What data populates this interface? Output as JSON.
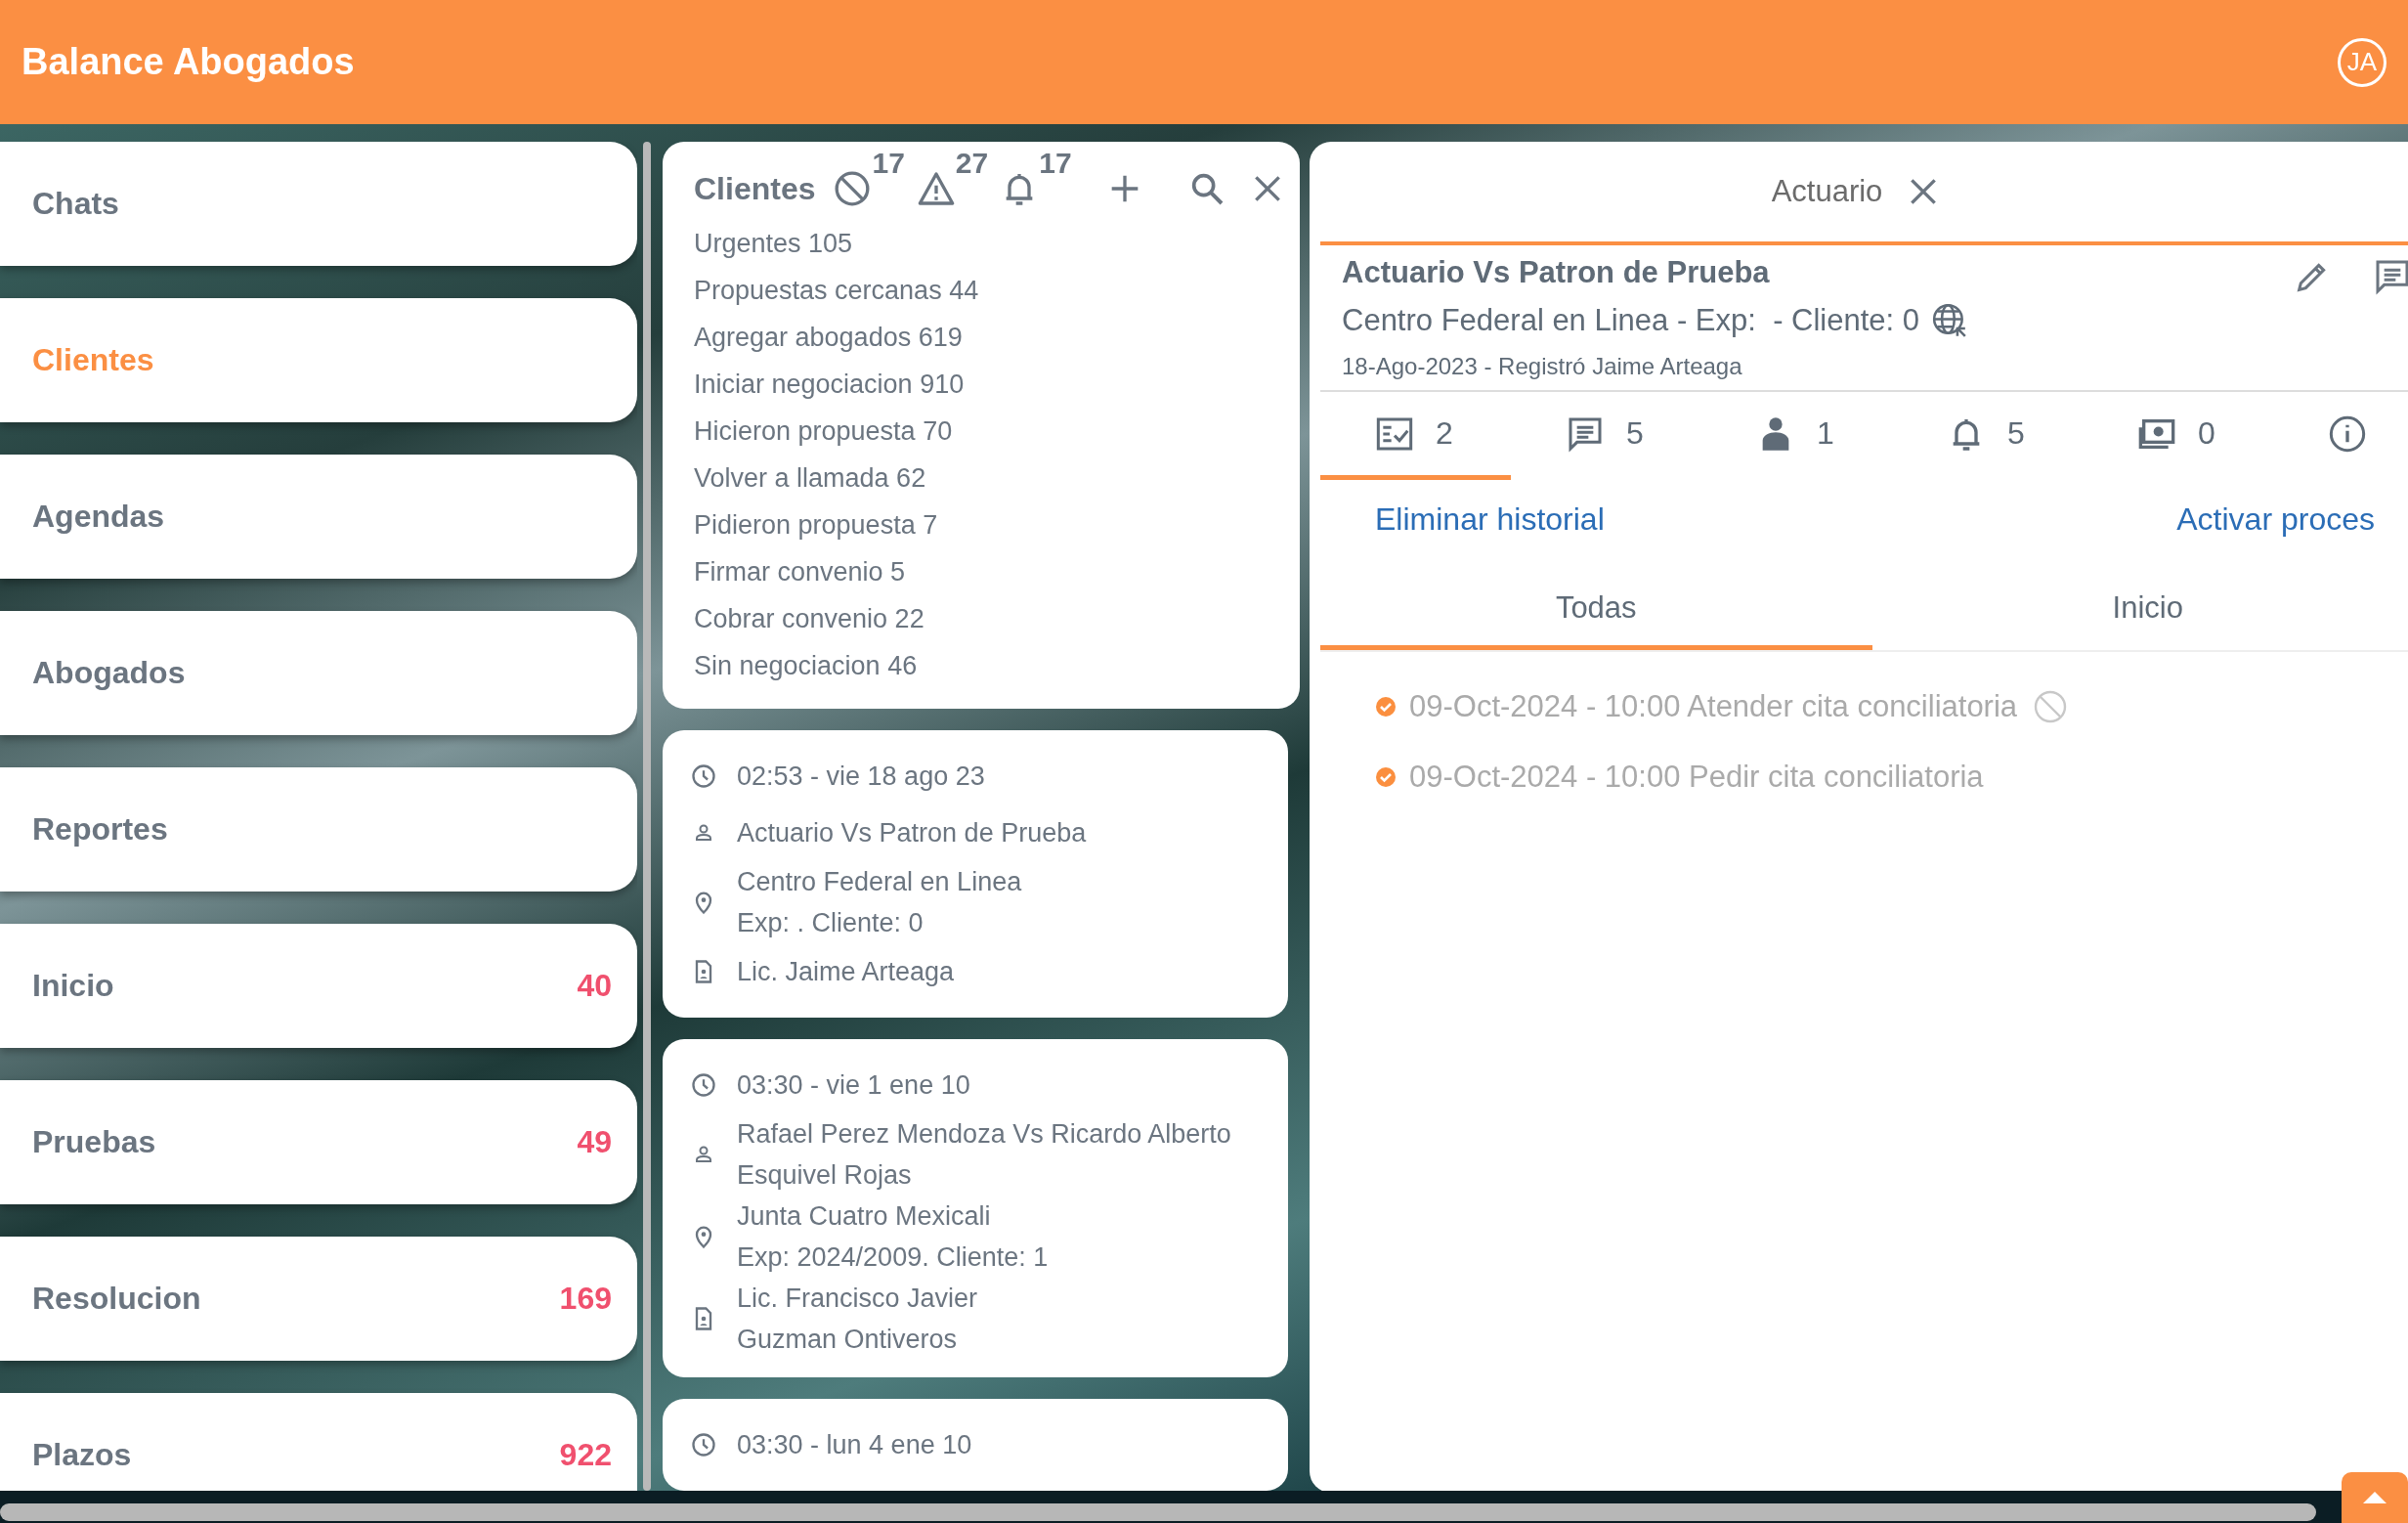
{
  "header": {
    "title": "Balance Abogados",
    "avatar": "JA"
  },
  "sidebar": {
    "items": [
      {
        "label": "Chats",
        "selected": false
      },
      {
        "label": "Clientes",
        "selected": true
      },
      {
        "label": "Agendas",
        "selected": false
      },
      {
        "label": "Abogados",
        "selected": false
      },
      {
        "label": "Reportes",
        "selected": false
      },
      {
        "label": "Inicio",
        "count": "40",
        "selected": false
      },
      {
        "label": "Pruebas",
        "count": "49",
        "selected": false
      },
      {
        "label": "Resolucion",
        "count": "169",
        "selected": false
      },
      {
        "label": "Plazos",
        "count": "922",
        "selected": false
      }
    ]
  },
  "clientes_panel": {
    "title": "Clientes",
    "counters": [
      {
        "kind": "blocked",
        "count": "17"
      },
      {
        "kind": "warning",
        "count": "27"
      },
      {
        "kind": "bell",
        "count": "17"
      }
    ],
    "filters": [
      "Urgentes 105",
      "Propuestas cercanas 44",
      "Agregar abogados 619",
      "Iniciar negociacion 910",
      "Hicieron propuesta 70",
      "Volver a llamada 62",
      "Pidieron propuesta 7",
      "Firmar convenio 5",
      "Cobrar convenio 22",
      "Sin negociacion 46"
    ]
  },
  "cards": [
    {
      "time": "02:53 - vie 18 ago 23",
      "parties": [
        "Actuario Vs Patron de Prueba"
      ],
      "location": [
        "Centro Federal en Linea",
        "Exp: . Cliente: 0"
      ],
      "lawyer": [
        "Lic. Jaime Arteaga"
      ]
    },
    {
      "time": "03:30 - vie 1 ene 10",
      "parties": [
        "Rafael Perez Mendoza Vs Ricardo Alberto",
        "Esquivel Rojas"
      ],
      "location": [
        "Junta Cuatro Mexicali",
        "Exp: 2024/2009. Cliente: 1"
      ],
      "lawyer": [
        "Lic. Francisco Javier",
        "Guzman Ontiveros"
      ]
    },
    {
      "time": "03:30 - lun 4 ene 10"
    }
  ],
  "detail": {
    "tab_title": "Actuario",
    "title": "Actuario Vs Patron de Prueba",
    "subtitle": "Centro Federal en Linea - Exp:  - Cliente: 0",
    "meta": "18-Ago-2023 - Registró Jaime Arteaga",
    "stats": [
      {
        "kind": "tasks",
        "count": "2",
        "selected": true
      },
      {
        "kind": "comments",
        "count": "5",
        "selected": false
      },
      {
        "kind": "person",
        "count": "1",
        "selected": false
      },
      {
        "kind": "bell",
        "count": "5",
        "selected": false
      },
      {
        "kind": "money",
        "count": "0",
        "selected": false
      },
      {
        "kind": "info",
        "selected": false
      }
    ],
    "actions": [
      "Eliminar historial",
      "Activar proces"
    ],
    "filter_tabs": [
      {
        "label": "Todas",
        "selected": true
      },
      {
        "label": "Inicio",
        "selected": false
      }
    ],
    "events": [
      {
        "text": "09-Oct-2024 - 10:00 Atender cita conciliatoria",
        "done": true,
        "blocked": true
      },
      {
        "text": "09-Oct-2024 - 10:00 Pedir cita conciliatoria",
        "done": true,
        "blocked": false
      }
    ]
  }
}
